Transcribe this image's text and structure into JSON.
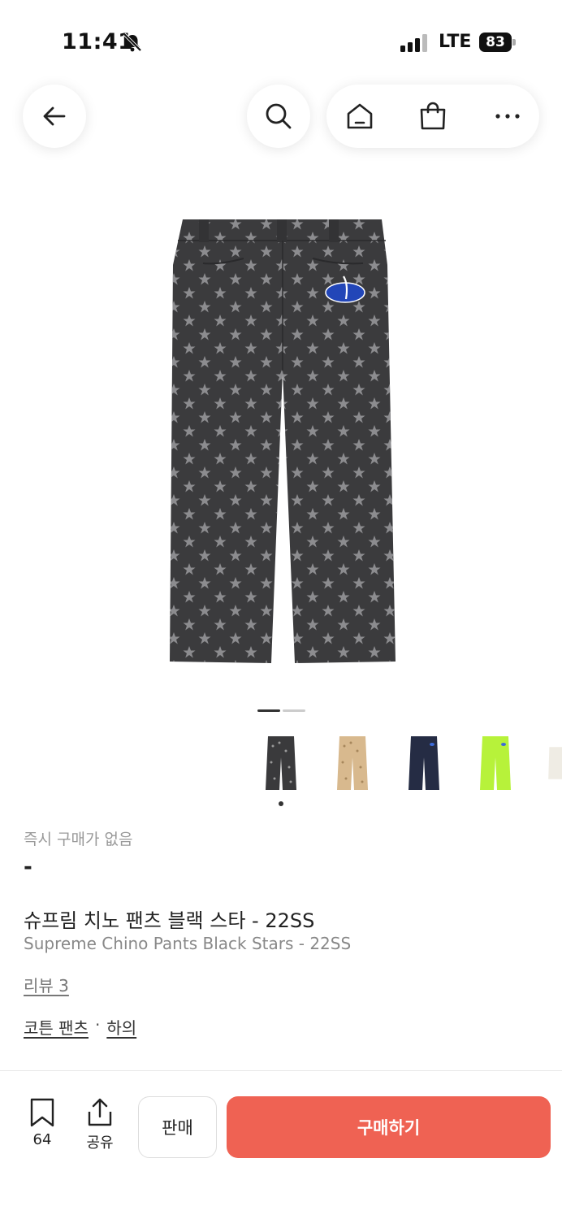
{
  "status_bar": {
    "time": "11:41",
    "network": "LTE",
    "battery": "83",
    "icons": [
      "bell-slash-icon",
      "signal-icon"
    ]
  },
  "header": {
    "icons": [
      "back-arrow-icon",
      "search-icon",
      "home-icon",
      "shopping-bag-icon",
      "more-icon"
    ]
  },
  "product": {
    "image_name": "supreme-chino-pants-black-stars",
    "image_count": 2,
    "active_image": 1,
    "colors": [
      {
        "name": "black-stars",
        "color": "#3a3a3c"
      },
      {
        "name": "tan-stars",
        "color": "#d8b98e"
      },
      {
        "name": "navy",
        "color": "#252c44"
      },
      {
        "name": "lime",
        "color": "#b7f23a"
      },
      {
        "name": "natural",
        "color": "#efece4"
      }
    ],
    "selected_color_index": 0,
    "instant_purchase_status": "즉시 구매가 없음",
    "price": "-",
    "title_ko": "슈프림 치노 팬츠 블랙 스타 - 22SS",
    "title_en": "Supreme Chino Pants Black Stars - 22SS",
    "review_link": "리뷰 3",
    "categories": [
      "코튼 팬츠",
      "하의"
    ],
    "category_separator": "·"
  },
  "bottom_bar": {
    "bookmark_count": "64",
    "share_label": "공유",
    "sell_label": "판매",
    "buy_label": "구매하기",
    "accent_color": "#ef6253"
  }
}
